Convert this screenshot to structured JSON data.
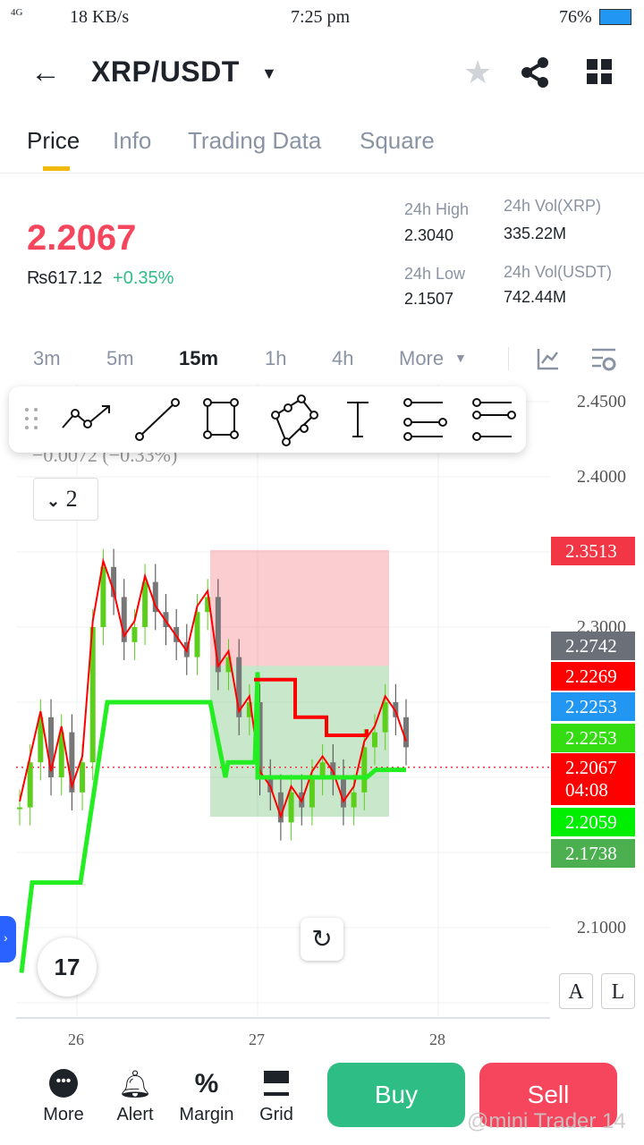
{
  "status": {
    "network": "4G",
    "speed": "18 KB/s",
    "time": "7:25 pm",
    "battery": "76%"
  },
  "header": {
    "pair": "XRP/USDT"
  },
  "tabs": [
    {
      "label": "Price"
    },
    {
      "label": "Info"
    },
    {
      "label": "Trading Data"
    },
    {
      "label": "Square"
    }
  ],
  "ticker": {
    "last": "2.2067",
    "fiat": "₨617.12",
    "change": "+0.35%",
    "high_label": "24h High",
    "high": "2.3040",
    "low_label": "24h Low",
    "low": "2.1507",
    "vol_label": "24h Vol(XRP)",
    "vol": "335.22M",
    "volu_label": "24h Vol(USDT)",
    "volu": "742.44M"
  },
  "timeframes": [
    "3m",
    "5m",
    "15m",
    "1h",
    "4h",
    "More"
  ],
  "chart": {
    "change_overlay": "−0.0072 (−0.33%)",
    "collapse_count": "2",
    "axis": [
      "2.4500",
      "2.4000",
      "2.3000",
      "2.1000"
    ],
    "xaxis": [
      "26",
      "27",
      "28"
    ],
    "tags": [
      {
        "v": "2.3513",
        "c": "#f23645"
      },
      {
        "v": "2.2742",
        "c": "#6b6f78"
      },
      {
        "v": "2.2269",
        "c": "#ff0000"
      },
      {
        "v": "2.2253",
        "c": "#2196f3"
      },
      {
        "v": "2.2253",
        "c": "#33dd11"
      },
      {
        "v": "2.2067",
        "c": "#ff0000",
        "t": "04:08"
      },
      {
        "v": "2.2059",
        "c": "#00ee00"
      },
      {
        "v": "2.1738",
        "c": "#4caf50"
      }
    ],
    "scale_a": "A",
    "scale_l": "L"
  },
  "chart_data": {
    "type": "line",
    "close": [
      2.18,
      2.21,
      2.24,
      2.2,
      2.23,
      2.19,
      2.21,
      2.3,
      2.34,
      2.32,
      2.29,
      2.3,
      2.33,
      2.31,
      2.3,
      2.29,
      2.28,
      2.31,
      2.32,
      2.27,
      2.28,
      2.24,
      2.25,
      2.2,
      2.19,
      2.17,
      2.19,
      2.18,
      2.2,
      2.21,
      2.2,
      2.18,
      2.19,
      2.22,
      2.23,
      2.25,
      2.24,
      2.22
    ],
    "stop_loss_top": 2.3513,
    "entry": 2.2742,
    "target": 2.1738
  },
  "bottom": {
    "more": "More",
    "alert": "Alert",
    "margin": "Margin",
    "grid": "Grid",
    "buy": "Buy",
    "sell": "Sell",
    "watermark": "@mini Trader 14"
  }
}
